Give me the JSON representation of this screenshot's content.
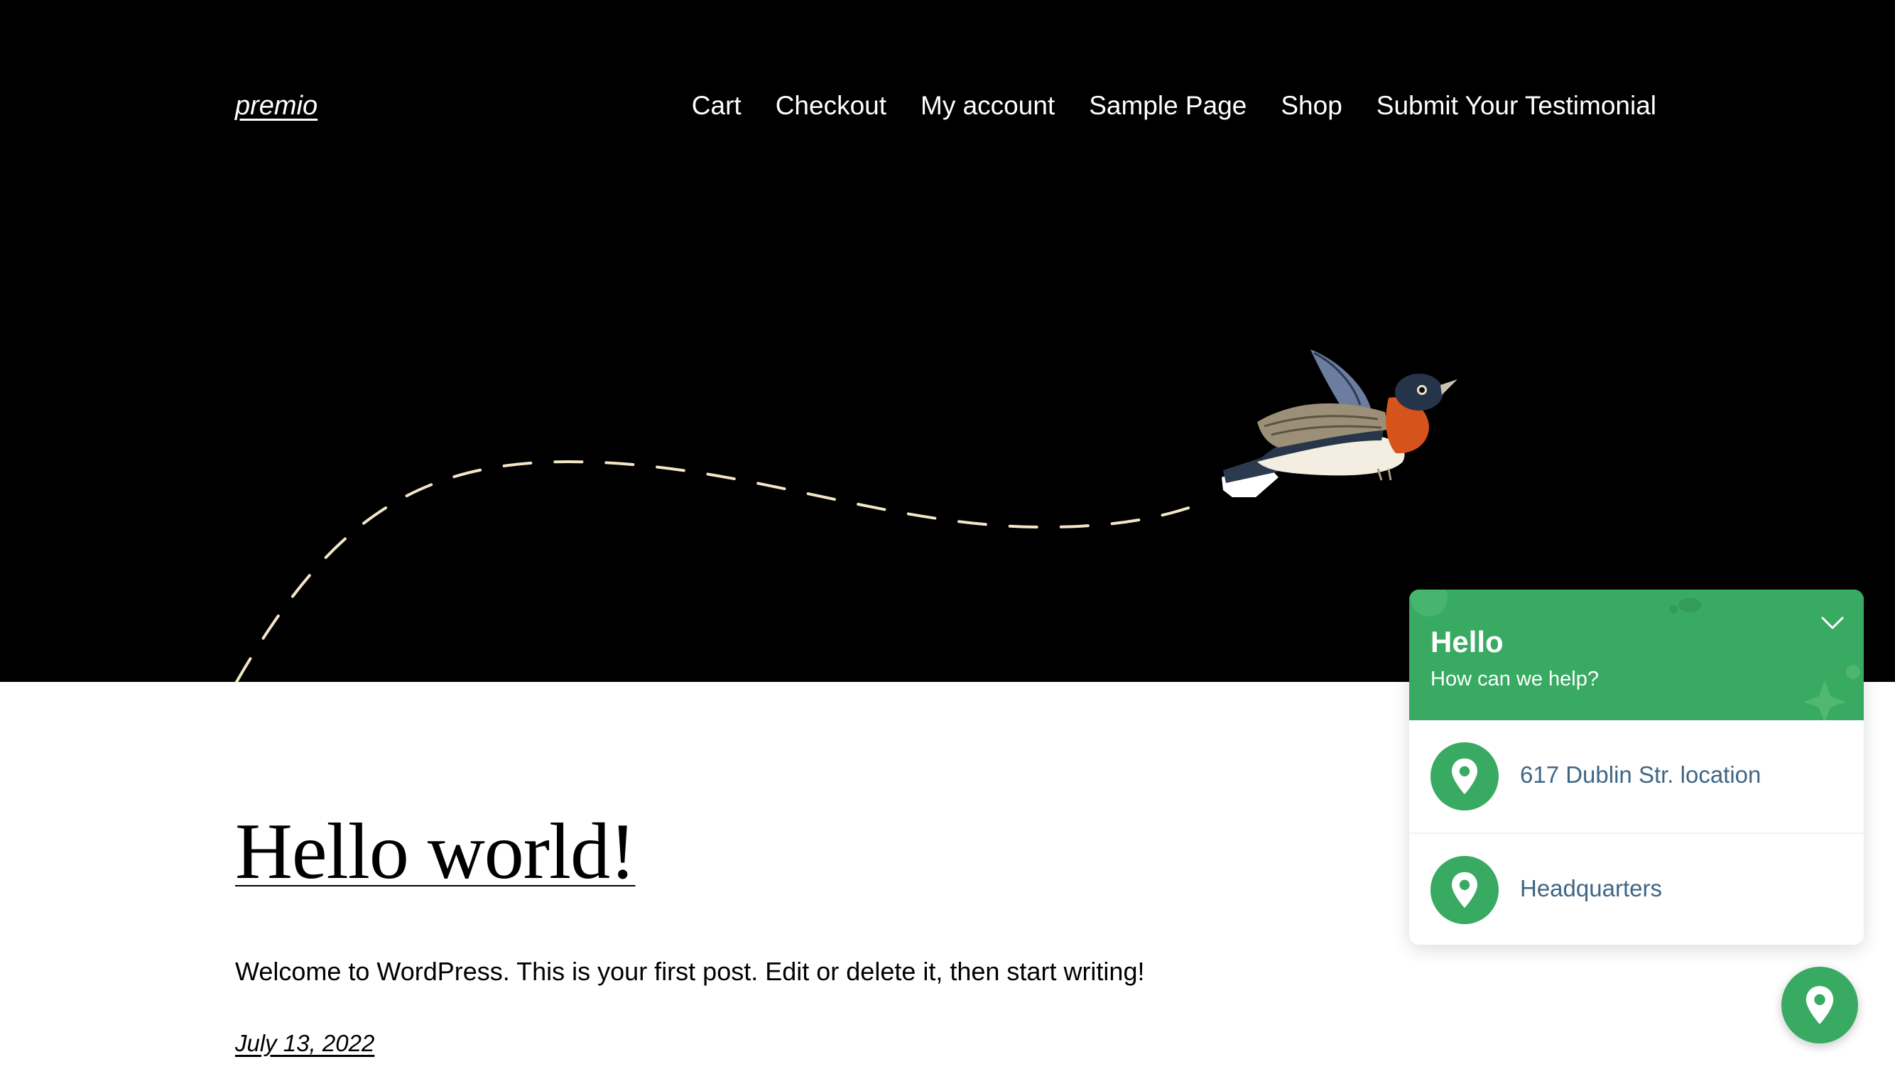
{
  "site": {
    "title": "premio"
  },
  "nav": {
    "items": [
      {
        "label": "Cart"
      },
      {
        "label": "Checkout"
      },
      {
        "label": "My account"
      },
      {
        "label": "Sample Page"
      },
      {
        "label": "Shop"
      },
      {
        "label": "Submit Your Testimonial"
      }
    ]
  },
  "post": {
    "title": "Hello world!",
    "excerpt": "Welcome to WordPress. This is your first post. Edit or delete it, then start writing!",
    "date": "July 13, 2022"
  },
  "widget": {
    "greeting": "Hello",
    "subtitle": "How can we help?",
    "items": [
      {
        "label": "617 Dublin Str. location",
        "icon": "map-pin-icon"
      },
      {
        "label": "Headquarters",
        "icon": "map-pin-icon"
      }
    ],
    "collapse_icon": "chevron-down-icon",
    "launcher_icon": "map-pin-icon"
  },
  "colors": {
    "hero_background": "#000000",
    "accent_green": "#38aa62",
    "widget_link_text": "#3f6685",
    "dashed_path": "#f4e6c7"
  }
}
